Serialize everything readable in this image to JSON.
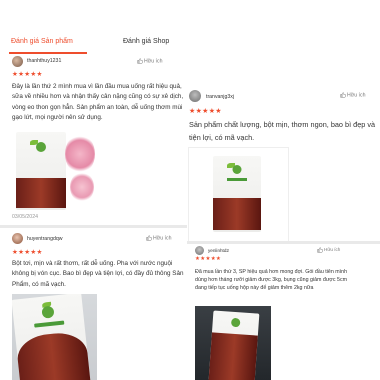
{
  "tabs": {
    "product_review": "Đánh giá Sản phẩm",
    "shop_review": "Đánh giá Shop"
  },
  "reviews_left": [
    {
      "username": "thanhthuy1231",
      "helpful": "Hữu ích",
      "stars": "★★★★★",
      "text": "Đây là lần thứ 2 mình mua vì lần đầu mua uống rất hiệu quả, sữa về nhiều hơn và nhận thấy cân nặng cũng có sự xê dịch, vòng eo thon gọn hẳn. Sản phẩm an toàn, dễ uống thơm mùi gạo lứt, mọi người nên sử dụng.",
      "date": "03/05/2024"
    },
    {
      "username": "huyentrangdqw",
      "helpful": "Hữu ích",
      "stars": "★★★★★",
      "text": "Bột tơi, mịn và rất thơm, rất dễ uống. Pha với nước nguội không bị vón cục. Bao bì đẹp và tiện lợi, có đầy đủ thông Sản Phẩm, có mã vạch."
    }
  ],
  "reviews_right": [
    {
      "username": "tranvanjg3xj",
      "helpful": "Hữu ích",
      "stars": "★★★★★",
      "text": "Sản phẩm chất lượng, bột mịn, thơm ngon, bao bì đẹp và tiện lợi, có mã vạch."
    },
    {
      "username": "yenlinhtd2",
      "helpful": "Hữu ích",
      "stars": "★★★★★",
      "text": "Đã mua lần thứ 3, SP hiệu quả hơn mong đợi. Gói đầu tiên mình dùng hơn tháng rưỡi giảm được 3kg, bụng cũng giảm được 5cm đang tiếp tục uống hộp này để giảm thêm 2kg nữa"
    }
  ],
  "colors": {
    "accent": "#ee4d2d",
    "divider": "#e9e9e9"
  },
  "icons": [
    "avatar",
    "thumbs-up-icon",
    "star-icon"
  ]
}
